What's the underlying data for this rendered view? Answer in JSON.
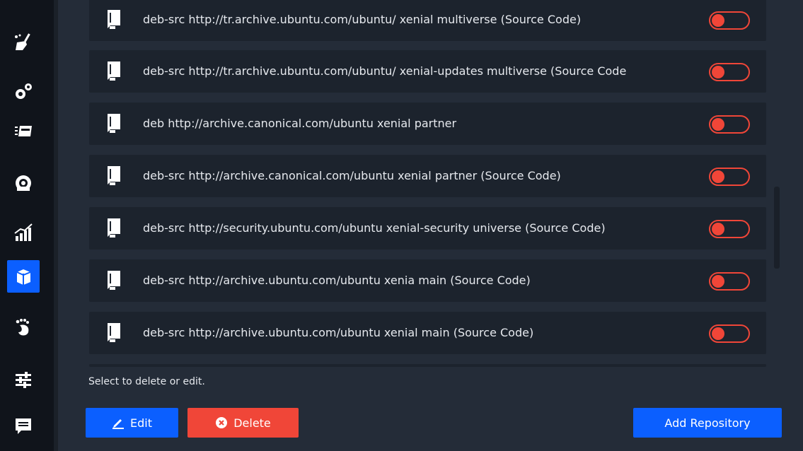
{
  "sidebar": {
    "items": [
      {
        "icon": "broom-icon",
        "active": false
      },
      {
        "icon": "gears-icon",
        "active": false
      },
      {
        "icon": "startup-apps-icon",
        "active": false
      },
      {
        "icon": "services-icon",
        "active": false
      },
      {
        "icon": "resources-chart-icon",
        "active": false
      },
      {
        "icon": "package-box-icon",
        "active": true
      },
      {
        "icon": "gnome-foot-icon",
        "active": false
      },
      {
        "icon": "sliders-icon",
        "active": false
      },
      {
        "icon": "comment-icon",
        "active": false
      }
    ]
  },
  "repositories": [
    {
      "text": "deb-src http://tr.archive.ubuntu.com/ubuntu/ xenial multiverse (Source Code)",
      "enabled": false
    },
    {
      "text": "deb-src http://tr.archive.ubuntu.com/ubuntu/ xenial-updates multiverse (Source Code",
      "enabled": false
    },
    {
      "text": "deb http://archive.canonical.com/ubuntu xenial partner",
      "enabled": false
    },
    {
      "text": "deb-src http://archive.canonical.com/ubuntu xenial partner (Source Code)",
      "enabled": false
    },
    {
      "text": "deb-src http://security.ubuntu.com/ubuntu xenial-security universe (Source Code)",
      "enabled": false
    },
    {
      "text": "deb-src http://archive.ubuntu.com/ubuntu xenia main (Source Code)",
      "enabled": false
    },
    {
      "text": "deb-src http://archive.ubuntu.com/ubuntu xenial main (Source Code)",
      "enabled": false
    }
  ],
  "footer": {
    "hint": "Select to delete or edit.",
    "edit_label": "Edit",
    "delete_label": "Delete",
    "add_label": "Add Repository"
  },
  "colors": {
    "accent": "#0b5fff",
    "danger": "#f04638",
    "row_bg": "#1c232d",
    "page_bg": "#242c38",
    "sidebar_bg": "#10141b"
  }
}
